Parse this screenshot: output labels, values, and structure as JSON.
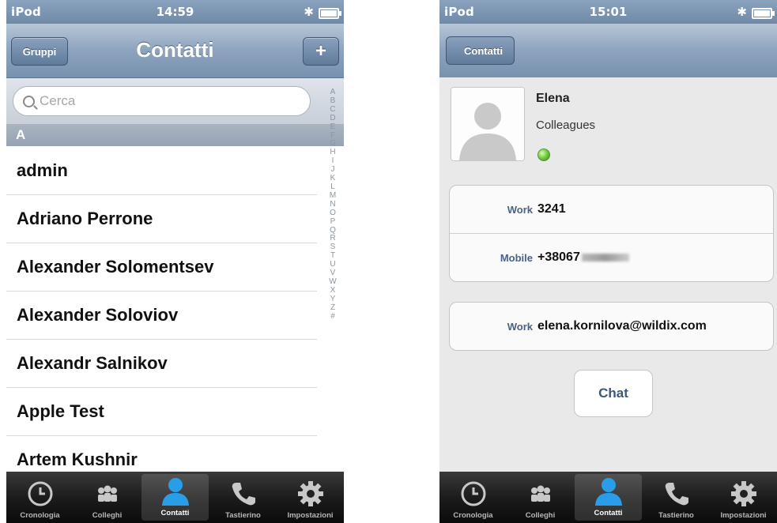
{
  "left": {
    "status": {
      "carrier": "iPod",
      "time": "14:59"
    },
    "nav": {
      "left_button": "Gruppi",
      "title": "Contatti",
      "right_button": "+"
    },
    "search": {
      "placeholder": "Cerca"
    },
    "section": "A",
    "contacts": [
      "admin",
      "Adriano Perrone",
      "Alexander Solomentsev",
      "Alexander Soloviov",
      "Alexandr Salnikov",
      "Apple Test",
      "Artem Kushnir"
    ],
    "index": [
      "A",
      "B",
      "C",
      "D",
      "E",
      "F",
      "G",
      "H",
      "I",
      "J",
      "K",
      "L",
      "M",
      "N",
      "O",
      "P",
      "Q",
      "R",
      "S",
      "T",
      "U",
      "V",
      "W",
      "X",
      "Y",
      "Z",
      "#"
    ]
  },
  "right": {
    "status": {
      "carrier": "iPod",
      "time": "15:01"
    },
    "nav": {
      "back_button": "Contatti"
    },
    "contact": {
      "name": "Elena",
      "group": "Colleagues",
      "presence_color": "#6cc23a"
    },
    "phones": [
      {
        "label": "Work",
        "value": "3241"
      },
      {
        "label": "Mobile",
        "value": "+38067"
      }
    ],
    "emails": [
      {
        "label": "Work",
        "value": "elena.kornilova@wildix.com"
      }
    ],
    "chat_button": "Chat"
  },
  "tabs": [
    {
      "label": "Cronologia",
      "icon": "clock-icon"
    },
    {
      "label": "Colleghi",
      "icon": "colleagues-icon"
    },
    {
      "label": "Contatti",
      "icon": "contact-icon",
      "active": true
    },
    {
      "label": "Tastierino",
      "icon": "phone-icon"
    },
    {
      "label": "Impostazioni",
      "icon": "gear-icon"
    }
  ],
  "colors": {
    "nav_blue": "#7891ae",
    "tab_active": "#2a9de8",
    "label_blue": "#4a6287"
  }
}
